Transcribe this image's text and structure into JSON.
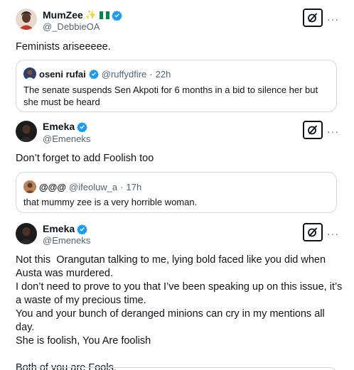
{
  "tweets": [
    {
      "name": "MumZee",
      "handle": "@_DebbieOA",
      "text": "Feminists ariseeeee.",
      "quote": {
        "name": "oseni rufai",
        "handle": "@ruffydfire",
        "time": "22h",
        "text": "The senate suspends Sen Akpoti for 6 months in a bid to silence her but she must be heard"
      }
    },
    {
      "name": "Emeka",
      "handle": "@Emeneks",
      "text": "Don’t forget to add Foolish too",
      "quote": {
        "name": "@@@",
        "handle": "@ifeoluw_a",
        "time": "17h",
        "text": "that mummy zee is a very horrible woman."
      }
    },
    {
      "name": "Emeka",
      "handle": "@Emeneks",
      "text": "Not this  Orangutan talking to me, lying bold faced like you did when Austa was murdered.\nI don’t need to prove to you that I’ve been speaking up on this issue, it’s a waste of my precious time.\nYou and your bunch of deranged minions can cry in my mentions all day.\nShe is foolish, You Are foolish\n\nBoth of you are Fools."
    }
  ],
  "ui": {
    "more_label": "···",
    "separator": "·"
  },
  "colors": {
    "verified_blue": "#1d9bf0",
    "secondary_text": "#536471",
    "border": "#cfd9de",
    "flag_green": "#008751"
  }
}
